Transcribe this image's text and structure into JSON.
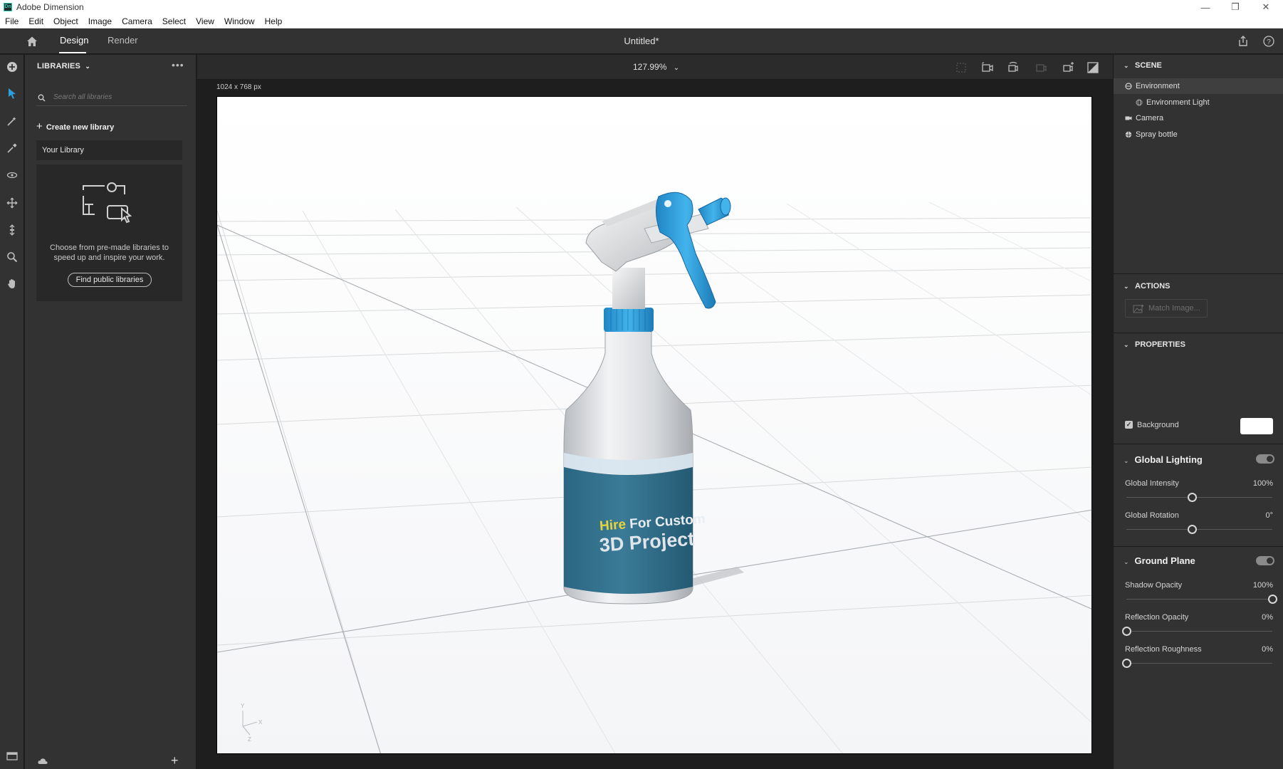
{
  "window": {
    "title": "Adobe Dimension",
    "app_icon_text": "Dn"
  },
  "menu": [
    "File",
    "Edit",
    "Object",
    "Image",
    "Camera",
    "Select",
    "View",
    "Window",
    "Help"
  ],
  "header": {
    "tabs": [
      {
        "label": "Design",
        "active": true
      },
      {
        "label": "Render",
        "active": false
      }
    ],
    "document_title": "Untitled*"
  },
  "tools": [
    "add-icon",
    "select-icon",
    "magic-wand-icon",
    "eyedropper-icon",
    "orbit-icon",
    "pan-icon",
    "dolly-icon",
    "zoom-icon",
    "hand-icon"
  ],
  "libraries": {
    "heading": "LIBRARIES",
    "search_placeholder": "Search all libraries",
    "create_label": "Create new library",
    "your_library": "Your Library",
    "empty_description": "Choose from pre-made libraries to speed up and inspire your work.",
    "find_button": "Find public libraries"
  },
  "canvas": {
    "zoom": "127.99%",
    "size_label": "1024 x 768 px",
    "label_text_line1_a": "Hire",
    "label_text_line1_b": " For Custom",
    "label_text_line2": "3D Project",
    "axis_y": "Y",
    "axis_x": "X",
    "axis_z": "Z"
  },
  "scene": {
    "heading": "SCENE",
    "items": [
      {
        "label": "Environment",
        "selected": true
      },
      {
        "label": "Environment Light",
        "selected": false
      },
      {
        "label": "Camera",
        "selected": false
      },
      {
        "label": "Spray bottle",
        "selected": false
      }
    ]
  },
  "actions": {
    "heading": "ACTIONS",
    "match_image": "Match Image..."
  },
  "properties": {
    "heading": "PROPERTIES",
    "background_label": "Background",
    "background_checked": true,
    "background_color": "#ffffff",
    "global_lighting": {
      "title": "Global Lighting",
      "enabled": true,
      "intensity_label": "Global Intensity",
      "intensity_value": "100%",
      "rotation_label": "Global Rotation",
      "rotation_value": "0°"
    },
    "ground_plane": {
      "title": "Ground Plane",
      "enabled": true,
      "shadow_label": "Shadow Opacity",
      "shadow_value": "100%",
      "reflection_label": "Reflection Opacity",
      "reflection_value": "0%",
      "roughness_label": "Reflection Roughness",
      "roughness_value": "0%"
    }
  },
  "colors": {
    "accent_blue": "#2a9fe0",
    "label_teal": "#2f6e86",
    "label_yellow": "#e8d43a"
  }
}
